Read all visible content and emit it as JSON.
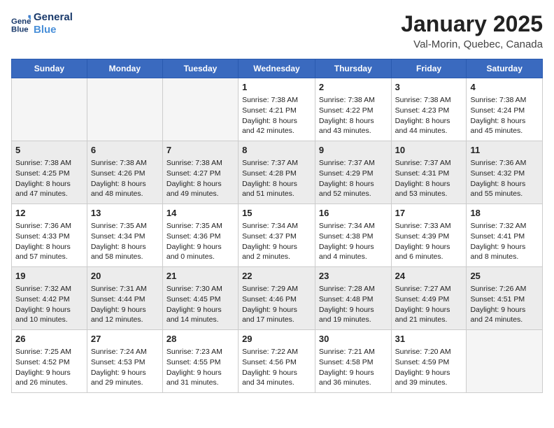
{
  "header": {
    "logo_line1": "General",
    "logo_line2": "Blue",
    "main_title": "January 2025",
    "sub_title": "Val-Morin, Quebec, Canada"
  },
  "days_of_week": [
    "Sunday",
    "Monday",
    "Tuesday",
    "Wednesday",
    "Thursday",
    "Friday",
    "Saturday"
  ],
  "weeks": [
    {
      "days": [
        {
          "num": "",
          "info": ""
        },
        {
          "num": "",
          "info": ""
        },
        {
          "num": "",
          "info": ""
        },
        {
          "num": "1",
          "info": "Sunrise: 7:38 AM\nSunset: 4:21 PM\nDaylight: 8 hours\nand 42 minutes."
        },
        {
          "num": "2",
          "info": "Sunrise: 7:38 AM\nSunset: 4:22 PM\nDaylight: 8 hours\nand 43 minutes."
        },
        {
          "num": "3",
          "info": "Sunrise: 7:38 AM\nSunset: 4:23 PM\nDaylight: 8 hours\nand 44 minutes."
        },
        {
          "num": "4",
          "info": "Sunrise: 7:38 AM\nSunset: 4:24 PM\nDaylight: 8 hours\nand 45 minutes."
        }
      ],
      "shaded": false
    },
    {
      "days": [
        {
          "num": "5",
          "info": "Sunrise: 7:38 AM\nSunset: 4:25 PM\nDaylight: 8 hours\nand 47 minutes."
        },
        {
          "num": "6",
          "info": "Sunrise: 7:38 AM\nSunset: 4:26 PM\nDaylight: 8 hours\nand 48 minutes."
        },
        {
          "num": "7",
          "info": "Sunrise: 7:38 AM\nSunset: 4:27 PM\nDaylight: 8 hours\nand 49 minutes."
        },
        {
          "num": "8",
          "info": "Sunrise: 7:37 AM\nSunset: 4:28 PM\nDaylight: 8 hours\nand 51 minutes."
        },
        {
          "num": "9",
          "info": "Sunrise: 7:37 AM\nSunset: 4:29 PM\nDaylight: 8 hours\nand 52 minutes."
        },
        {
          "num": "10",
          "info": "Sunrise: 7:37 AM\nSunset: 4:31 PM\nDaylight: 8 hours\nand 53 minutes."
        },
        {
          "num": "11",
          "info": "Sunrise: 7:36 AM\nSunset: 4:32 PM\nDaylight: 8 hours\nand 55 minutes."
        }
      ],
      "shaded": true
    },
    {
      "days": [
        {
          "num": "12",
          "info": "Sunrise: 7:36 AM\nSunset: 4:33 PM\nDaylight: 8 hours\nand 57 minutes."
        },
        {
          "num": "13",
          "info": "Sunrise: 7:35 AM\nSunset: 4:34 PM\nDaylight: 8 hours\nand 58 minutes."
        },
        {
          "num": "14",
          "info": "Sunrise: 7:35 AM\nSunset: 4:36 PM\nDaylight: 9 hours\nand 0 minutes."
        },
        {
          "num": "15",
          "info": "Sunrise: 7:34 AM\nSunset: 4:37 PM\nDaylight: 9 hours\nand 2 minutes."
        },
        {
          "num": "16",
          "info": "Sunrise: 7:34 AM\nSunset: 4:38 PM\nDaylight: 9 hours\nand 4 minutes."
        },
        {
          "num": "17",
          "info": "Sunrise: 7:33 AM\nSunset: 4:39 PM\nDaylight: 9 hours\nand 6 minutes."
        },
        {
          "num": "18",
          "info": "Sunrise: 7:32 AM\nSunset: 4:41 PM\nDaylight: 9 hours\nand 8 minutes."
        }
      ],
      "shaded": false
    },
    {
      "days": [
        {
          "num": "19",
          "info": "Sunrise: 7:32 AM\nSunset: 4:42 PM\nDaylight: 9 hours\nand 10 minutes."
        },
        {
          "num": "20",
          "info": "Sunrise: 7:31 AM\nSunset: 4:44 PM\nDaylight: 9 hours\nand 12 minutes."
        },
        {
          "num": "21",
          "info": "Sunrise: 7:30 AM\nSunset: 4:45 PM\nDaylight: 9 hours\nand 14 minutes."
        },
        {
          "num": "22",
          "info": "Sunrise: 7:29 AM\nSunset: 4:46 PM\nDaylight: 9 hours\nand 17 minutes."
        },
        {
          "num": "23",
          "info": "Sunrise: 7:28 AM\nSunset: 4:48 PM\nDaylight: 9 hours\nand 19 minutes."
        },
        {
          "num": "24",
          "info": "Sunrise: 7:27 AM\nSunset: 4:49 PM\nDaylight: 9 hours\nand 21 minutes."
        },
        {
          "num": "25",
          "info": "Sunrise: 7:26 AM\nSunset: 4:51 PM\nDaylight: 9 hours\nand 24 minutes."
        }
      ],
      "shaded": true
    },
    {
      "days": [
        {
          "num": "26",
          "info": "Sunrise: 7:25 AM\nSunset: 4:52 PM\nDaylight: 9 hours\nand 26 minutes."
        },
        {
          "num": "27",
          "info": "Sunrise: 7:24 AM\nSunset: 4:53 PM\nDaylight: 9 hours\nand 29 minutes."
        },
        {
          "num": "28",
          "info": "Sunrise: 7:23 AM\nSunset: 4:55 PM\nDaylight: 9 hours\nand 31 minutes."
        },
        {
          "num": "29",
          "info": "Sunrise: 7:22 AM\nSunset: 4:56 PM\nDaylight: 9 hours\nand 34 minutes."
        },
        {
          "num": "30",
          "info": "Sunrise: 7:21 AM\nSunset: 4:58 PM\nDaylight: 9 hours\nand 36 minutes."
        },
        {
          "num": "31",
          "info": "Sunrise: 7:20 AM\nSunset: 4:59 PM\nDaylight: 9 hours\nand 39 minutes."
        },
        {
          "num": "",
          "info": ""
        }
      ],
      "shaded": false
    }
  ]
}
